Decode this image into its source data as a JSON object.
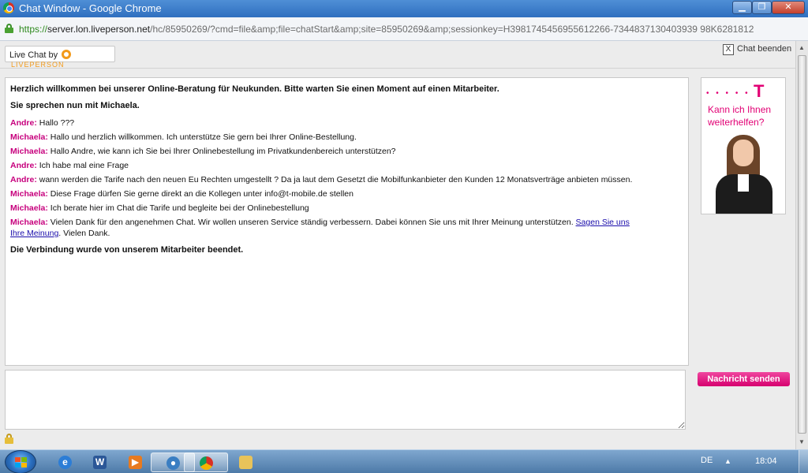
{
  "window": {
    "title": "Chat Window - Google Chrome",
    "minimize_glyph": "▁",
    "maximize_glyph": "❐",
    "close_glyph": "✕"
  },
  "address_bar": {
    "scheme": "https://",
    "host": "server.lon.liveperson.net",
    "path": "/hc/85950269/?cmd=file&amp;file=chatStart&amp;site=85950269&amp;sessionkey=H3981745456955612266-7344837130403939 98K6281812"
  },
  "header": {
    "live_chat_label": "Live Chat by",
    "liveperson_label": "LIVEPERSON",
    "end_chat_x": "X",
    "end_chat_label": "Chat beenden"
  },
  "transcript": {
    "welcome": "Herzlich willkommen bei unserer Online-Beratung für Neukunden. Bitte warten Sie einen Moment auf einen Mitarbeiter.",
    "connected": "Sie sprechen nun mit Michaela.",
    "messages": [
      {
        "sender": "Andre:",
        "text": " Hallo ???"
      },
      {
        "sender": "Michaela:",
        "text": " Hallo und herzlich willkommen. Ich unterstütze Sie gern bei Ihrer Online-Bestellung."
      },
      {
        "sender": "Michaela:",
        "text": " Hallo Andre, wie kann ich Sie bei Ihrer Onlinebestellung im Privatkundenbereich unterstützen?"
      },
      {
        "sender": "Andre:",
        "text": " Ich habe mal eine Frage"
      },
      {
        "sender": "Andre:",
        "text": " wann werden die Tarife nach den neuen Eu Rechten umgestellt ? Da ja laut dem Gesetzt die Mobilfunkanbieter den Kunden 12 Monatsverträge anbieten müssen."
      },
      {
        "sender": "Michaela:",
        "text": " Diese Frage dürfen Sie gerne direkt an die Kollegen unter info@t-mobile.de stellen"
      },
      {
        "sender": "Michaela:",
        "text": " Ich berate hier im Chat die Tarife und begleite bei der Onlinebestellung"
      }
    ],
    "last_message": {
      "sender": "Michaela:",
      "text_before": " Vielen Dank für den angenehmen Chat. Wir wollen unseren Service ständig verbessern. Dabei können Sie uns mit Ihrer Meinung unterstützen. ",
      "link": "Sagen Sie uns Ihre Meinung",
      "text_after": ". Vielen Dank."
    },
    "ended": "Die Verbindung wurde von unserem Mitarbeiter beendet."
  },
  "ad": {
    "dots": "• • • • •",
    "logo": "T",
    "tagline": "Kann ich Ihnen weiterhelfen?"
  },
  "compose": {
    "value": "",
    "send_label": "Nachricht senden"
  },
  "taskbar": {
    "apps": [
      "internet-explorer",
      "word",
      "media-player",
      "messenger",
      "chrome",
      "file-explorer"
    ],
    "language": "DE",
    "tray_arrow": "▲",
    "time": "18:04"
  }
}
